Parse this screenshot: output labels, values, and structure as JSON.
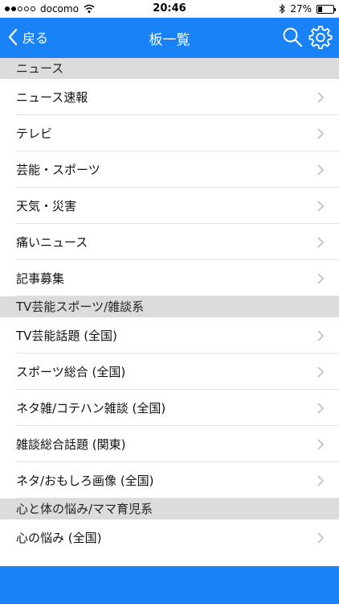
{
  "status_bar": {
    "carrier": "docomo",
    "time": "20:46",
    "battery": "27%",
    "battery_level": 0.27
  },
  "navbar": {
    "back_label": "戻る",
    "title": "板一覧"
  },
  "sections": [
    {
      "title": "ニュース",
      "items": [
        "ニュース速報",
        "テレビ",
        "芸能・スポーツ",
        "天気・災害",
        "痛いニュース",
        "記事募集"
      ]
    },
    {
      "title": "TV芸能スポーツ/雑談系",
      "items": [
        "TV芸能話題 (全国)",
        "スポーツ総合 (全国)",
        "ネタ雑/コテハン雑談 (全国)",
        "雑談総合話題 (関東)",
        "ネタ/おもしろ画像 (全国)"
      ]
    },
    {
      "title": "心と体の悩み/ママ育児系",
      "items": [
        "心の悩み (全国)"
      ]
    }
  ]
}
